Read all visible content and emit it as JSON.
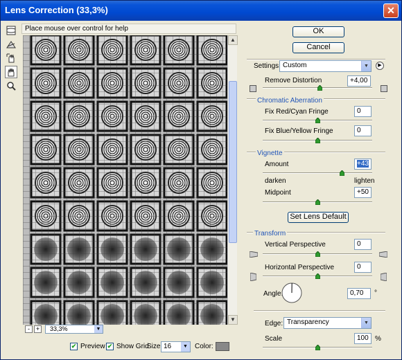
{
  "window": {
    "title": "Lens Correction (33,3%)"
  },
  "help": {
    "text": "Place mouse over control for help"
  },
  "tools": [
    "remove-distortion-tool-icon",
    "straighten-tool-icon",
    "move-grid-tool-icon",
    "hand-tool-icon",
    "zoom-tool-icon"
  ],
  "zoom": {
    "minus": "-",
    "plus": "+",
    "value": "33,3%"
  },
  "bottom": {
    "preview_label": "Preview",
    "preview_checked": true,
    "show_grid_label": "Show Grid",
    "show_grid_checked": true,
    "size_label": "Size:",
    "size_value": "16",
    "color_label": "Color:",
    "color_value": "#888888"
  },
  "buttons": {
    "ok": "OK",
    "cancel": "Cancel",
    "lens_default": "Set Lens Default"
  },
  "settings": {
    "label": "Settings:",
    "value": "Custom"
  },
  "remove_distortion": {
    "label": "Remove Distortion",
    "value": "+4,00",
    "position": 0.52
  },
  "chromatic": {
    "title": "Chromatic Aberration",
    "red_cyan_label": "Fix Red/Cyan Fringe",
    "red_cyan_value": "0",
    "red_cyan_position": 0.5,
    "blue_yellow_label": "Fix Blue/Yellow Fringe",
    "blue_yellow_value": "0",
    "blue_yellow_position": 0.5
  },
  "vignette": {
    "title": "Vignette",
    "amount_label": "Amount",
    "amount_value": "+43",
    "amount_position": 0.72,
    "darken_label": "darken",
    "lighten_label": "lighten",
    "midpoint_label": "Midpoint",
    "midpoint_value": "+50",
    "midpoint_position": 0.5
  },
  "transform": {
    "title": "Transform",
    "vertical_label": "Vertical Perspective",
    "vertical_value": "0",
    "vertical_position": 0.5,
    "horizontal_label": "Horizontal Perspective",
    "horizontal_value": "0",
    "horizontal_position": 0.5,
    "angle_label": "Angle:",
    "angle_value": "0,70",
    "angle_unit": "°",
    "edge_label": "Edge:",
    "edge_value": "Transparency",
    "scale_label": "Scale",
    "scale_value": "100",
    "scale_unit": "%",
    "scale_position": 0.5
  }
}
